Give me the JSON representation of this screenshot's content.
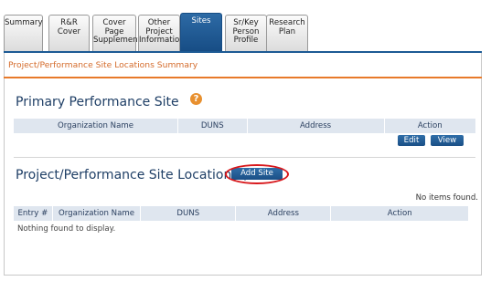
{
  "tabs": [
    {
      "label": "Summary",
      "active": false
    },
    {
      "label": "R&R Cover",
      "active": false
    },
    {
      "label": "Cover Page\nSupplement",
      "active": false
    },
    {
      "label": "Other\nProject\nInformation",
      "active": false
    },
    {
      "label": "Sites",
      "active": true
    },
    {
      "label": "Sr/Key\nPerson\nProfile",
      "active": false
    },
    {
      "label": "Research\nPlan",
      "active": false
    }
  ],
  "breadcrumb": "Project/Performance Site Locations Summary",
  "primary": {
    "title": "Primary Performance Site",
    "help_icon": "?",
    "columns": [
      "Organization Name",
      "DUNS",
      "Address",
      "Action"
    ],
    "edit_label": "Edit",
    "view_label": "View"
  },
  "locations": {
    "title": "Project/Performance Site Location(s)",
    "add_label": "Add Site",
    "status": "No items found.",
    "columns": [
      "Entry #",
      "Organization Name",
      "DUNS",
      "Address",
      "Action"
    ],
    "empty": "Nothing found to display."
  },
  "colors": {
    "accent": "#1c5a94",
    "orange": "#e87a2a",
    "highlight": "#d8181c"
  }
}
